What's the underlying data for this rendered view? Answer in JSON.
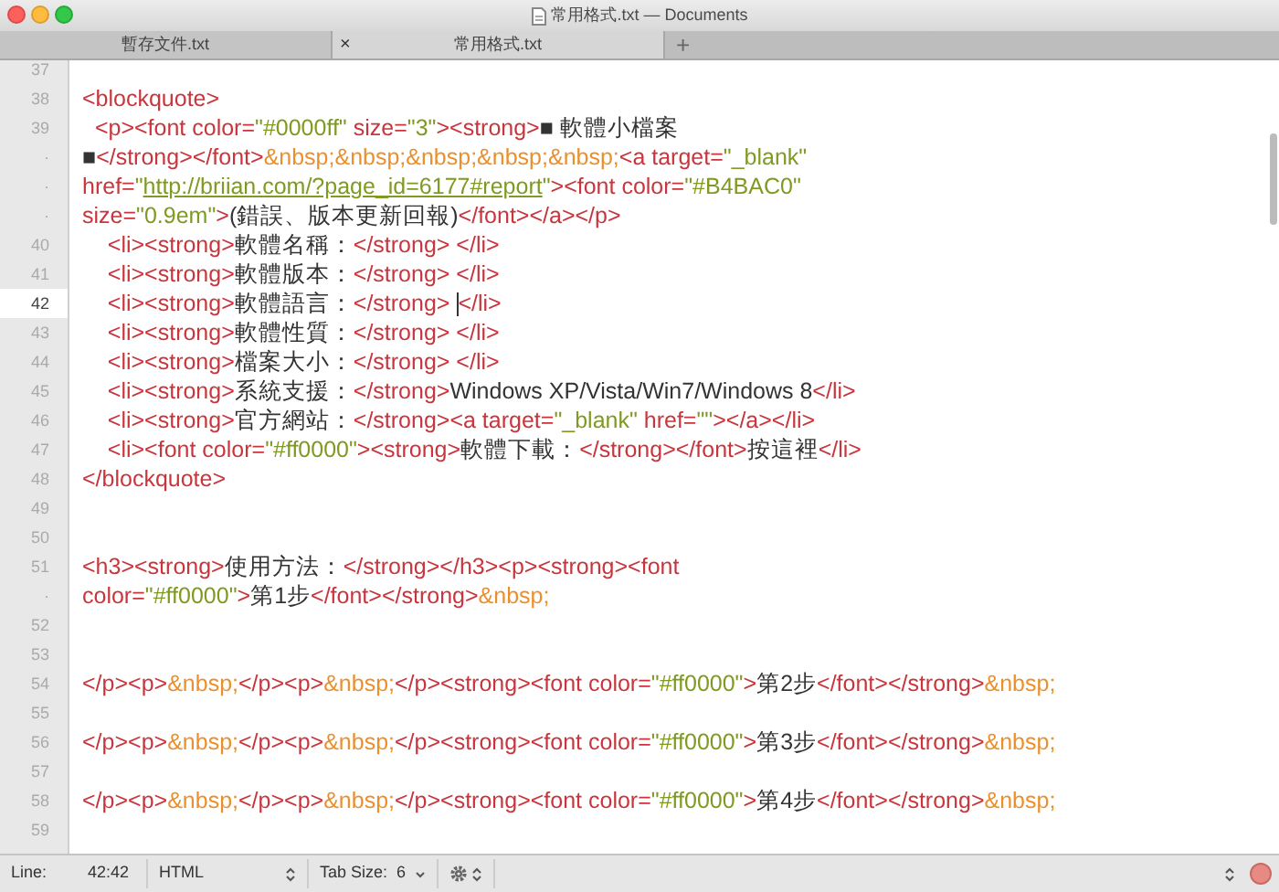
{
  "window": {
    "title": "常用格式.txt — Documents"
  },
  "tabs": [
    {
      "label": "暫存文件.txt",
      "selected": false
    },
    {
      "label": "常用格式.txt",
      "selected": true,
      "close": "×"
    }
  ],
  "new_tab": "+",
  "editor": {
    "lines": [
      {
        "number": "37",
        "current": false
      },
      {
        "number": "38",
        "current": false,
        "segments": [
          {
            "kind": "tag",
            "text": "<blockquote>"
          }
        ]
      },
      {
        "number": "39",
        "current": false,
        "segments": [
          {
            "kind": "tag",
            "text": "  <p><font color="
          },
          {
            "kind": "string",
            "text": "\"#0000ff\""
          },
          {
            "kind": "tag",
            "text": " size="
          },
          {
            "kind": "string",
            "text": "\"3\""
          },
          {
            "kind": "tag",
            "text": "><strong>"
          },
          {
            "kind": "text",
            "text": "■ 軟體小檔案"
          }
        ]
      },
      {
        "number": "·",
        "current": false,
        "segments": [
          {
            "kind": "text",
            "text": "■"
          },
          {
            "kind": "tag",
            "text": "</strong></font>"
          },
          {
            "kind": "entity",
            "text": "&nbsp;&nbsp;&nbsp;&nbsp;&nbsp;"
          },
          {
            "kind": "tag",
            "text": "<a target="
          },
          {
            "kind": "string",
            "text": "\"_blank\""
          }
        ]
      },
      {
        "number": "·",
        "current": false,
        "segments": [
          {
            "kind": "tag",
            "text": "href="
          },
          {
            "kind": "string",
            "text": "\""
          },
          {
            "kind": "url",
            "text": "http://briian.com/?page_id=6177#report"
          },
          {
            "kind": "string",
            "text": "\""
          },
          {
            "kind": "tag",
            "text": "><font color="
          },
          {
            "kind": "string",
            "text": "\"#B4BAC0\""
          }
        ]
      },
      {
        "number": "·",
        "current": false,
        "segments": [
          {
            "kind": "tag",
            "text": "size="
          },
          {
            "kind": "string",
            "text": "\"0.9em\""
          },
          {
            "kind": "tag",
            "text": ">"
          },
          {
            "kind": "text",
            "text": "(錯誤、版本更新回報)"
          },
          {
            "kind": "tag",
            "text": "</font></a></p>"
          }
        ]
      },
      {
        "number": "40",
        "current": false,
        "segments": [
          {
            "kind": "tag",
            "text": "    <li><strong>"
          },
          {
            "kind": "text",
            "text": "軟體名稱："
          },
          {
            "kind": "tag",
            "text": "</strong> </li>"
          }
        ]
      },
      {
        "number": "41",
        "current": false,
        "segments": [
          {
            "kind": "tag",
            "text": "    <li><strong>"
          },
          {
            "kind": "text",
            "text": "軟體版本："
          },
          {
            "kind": "tag",
            "text": "</strong> </li>"
          }
        ]
      },
      {
        "number": "42",
        "current": true,
        "segments": [
          {
            "kind": "tag",
            "text": "    <li><strong>"
          },
          {
            "kind": "text",
            "text": "軟體語言："
          },
          {
            "kind": "tag",
            "text": "</strong> "
          },
          {
            "kind": "tag",
            "text": "</li>",
            "cursor_before": true
          }
        ]
      },
      {
        "number": "43",
        "current": false,
        "segments": [
          {
            "kind": "tag",
            "text": "    <li><strong>"
          },
          {
            "kind": "text",
            "text": "軟體性質："
          },
          {
            "kind": "tag",
            "text": "</strong> </li>"
          }
        ]
      },
      {
        "number": "44",
        "current": false,
        "segments": [
          {
            "kind": "tag",
            "text": "    <li><strong>"
          },
          {
            "kind": "text",
            "text": "檔案大小："
          },
          {
            "kind": "tag",
            "text": "</strong> </li>"
          }
        ]
      },
      {
        "number": "45",
        "current": false,
        "segments": [
          {
            "kind": "tag",
            "text": "    <li><strong>"
          },
          {
            "kind": "text",
            "text": "系統支援："
          },
          {
            "kind": "tag",
            "text": "</strong>"
          },
          {
            "kind": "text",
            "text": "Windows XP/Vista/Win7/Windows 8"
          },
          {
            "kind": "tag",
            "text": "</li>"
          }
        ]
      },
      {
        "number": "46",
        "current": false,
        "segments": [
          {
            "kind": "tag",
            "text": "    <li><strong>"
          },
          {
            "kind": "text",
            "text": "官方網站："
          },
          {
            "kind": "tag",
            "text": "</strong><a target="
          },
          {
            "kind": "string",
            "text": "\"_blank\""
          },
          {
            "kind": "tag",
            "text": " href="
          },
          {
            "kind": "string",
            "text": "\"\""
          },
          {
            "kind": "tag",
            "text": "></a></li>"
          }
        ]
      },
      {
        "number": "47",
        "current": false,
        "segments": [
          {
            "kind": "tag",
            "text": "    <li><font color="
          },
          {
            "kind": "string",
            "text": "\"#ff0000\""
          },
          {
            "kind": "tag",
            "text": "><strong>"
          },
          {
            "kind": "text",
            "text": "軟體下載："
          },
          {
            "kind": "tag",
            "text": "</strong></font>"
          },
          {
            "kind": "text",
            "text": "按這裡"
          },
          {
            "kind": "tag",
            "text": "</li>"
          }
        ]
      },
      {
        "number": "48",
        "current": false,
        "segments": [
          {
            "kind": "tag",
            "text": "</blockquote>"
          }
        ]
      },
      {
        "number": "49",
        "current": false
      },
      {
        "number": "50",
        "current": false
      },
      {
        "number": "51",
        "current": false,
        "segments": [
          {
            "kind": "tag",
            "text": "<h3><strong>"
          },
          {
            "kind": "text",
            "text": "使用方法："
          },
          {
            "kind": "tag",
            "text": "</strong></h3><p><strong><font"
          }
        ]
      },
      {
        "number": "·",
        "current": false,
        "segments": [
          {
            "kind": "tag",
            "text": "color="
          },
          {
            "kind": "string",
            "text": "\"#ff0000\""
          },
          {
            "kind": "tag",
            "text": ">"
          },
          {
            "kind": "text",
            "text": "第1步"
          },
          {
            "kind": "tag",
            "text": "</font></strong>"
          },
          {
            "kind": "entity",
            "text": "&nbsp;"
          }
        ]
      },
      {
        "number": "52",
        "current": false
      },
      {
        "number": "53",
        "current": false
      },
      {
        "number": "54",
        "current": false,
        "segments": [
          {
            "kind": "tag",
            "text": "</p><p>"
          },
          {
            "kind": "entity",
            "text": "&nbsp;"
          },
          {
            "kind": "tag",
            "text": "</p><p>"
          },
          {
            "kind": "entity",
            "text": "&nbsp;"
          },
          {
            "kind": "tag",
            "text": "</p><strong><font color="
          },
          {
            "kind": "string",
            "text": "\"#ff0000\""
          },
          {
            "kind": "tag",
            "text": ">"
          },
          {
            "kind": "text",
            "text": "第2步"
          },
          {
            "kind": "tag",
            "text": "</font></strong>"
          },
          {
            "kind": "entity",
            "text": "&nbsp;"
          }
        ]
      },
      {
        "number": "55",
        "current": false
      },
      {
        "number": "56",
        "current": false,
        "segments": [
          {
            "kind": "tag",
            "text": "</p><p>"
          },
          {
            "kind": "entity",
            "text": "&nbsp;"
          },
          {
            "kind": "tag",
            "text": "</p><p>"
          },
          {
            "kind": "entity",
            "text": "&nbsp;"
          },
          {
            "kind": "tag",
            "text": "</p><strong><font color="
          },
          {
            "kind": "string",
            "text": "\"#ff0000\""
          },
          {
            "kind": "tag",
            "text": ">"
          },
          {
            "kind": "text",
            "text": "第3步"
          },
          {
            "kind": "tag",
            "text": "</font></strong>"
          },
          {
            "kind": "entity",
            "text": "&nbsp;"
          }
        ]
      },
      {
        "number": "57",
        "current": false
      },
      {
        "number": "58",
        "current": false,
        "segments": [
          {
            "kind": "tag",
            "text": "</p><p>"
          },
          {
            "kind": "entity",
            "text": "&nbsp;"
          },
          {
            "kind": "tag",
            "text": "</p><p>"
          },
          {
            "kind": "entity",
            "text": "&nbsp;"
          },
          {
            "kind": "tag",
            "text": "</p><strong><font color="
          },
          {
            "kind": "string",
            "text": "\"#ff0000\""
          },
          {
            "kind": "tag",
            "text": ">"
          },
          {
            "kind": "text",
            "text": "第4步"
          },
          {
            "kind": "tag",
            "text": "</font></strong>"
          },
          {
            "kind": "entity",
            "text": "&nbsp;"
          }
        ]
      },
      {
        "number": "59",
        "current": false
      }
    ]
  },
  "status_bar": {
    "line_label": "Line:",
    "line_value": "42:42",
    "syntax": "HTML",
    "tab_size_label": "Tab Size:",
    "tab_size": "6"
  }
}
